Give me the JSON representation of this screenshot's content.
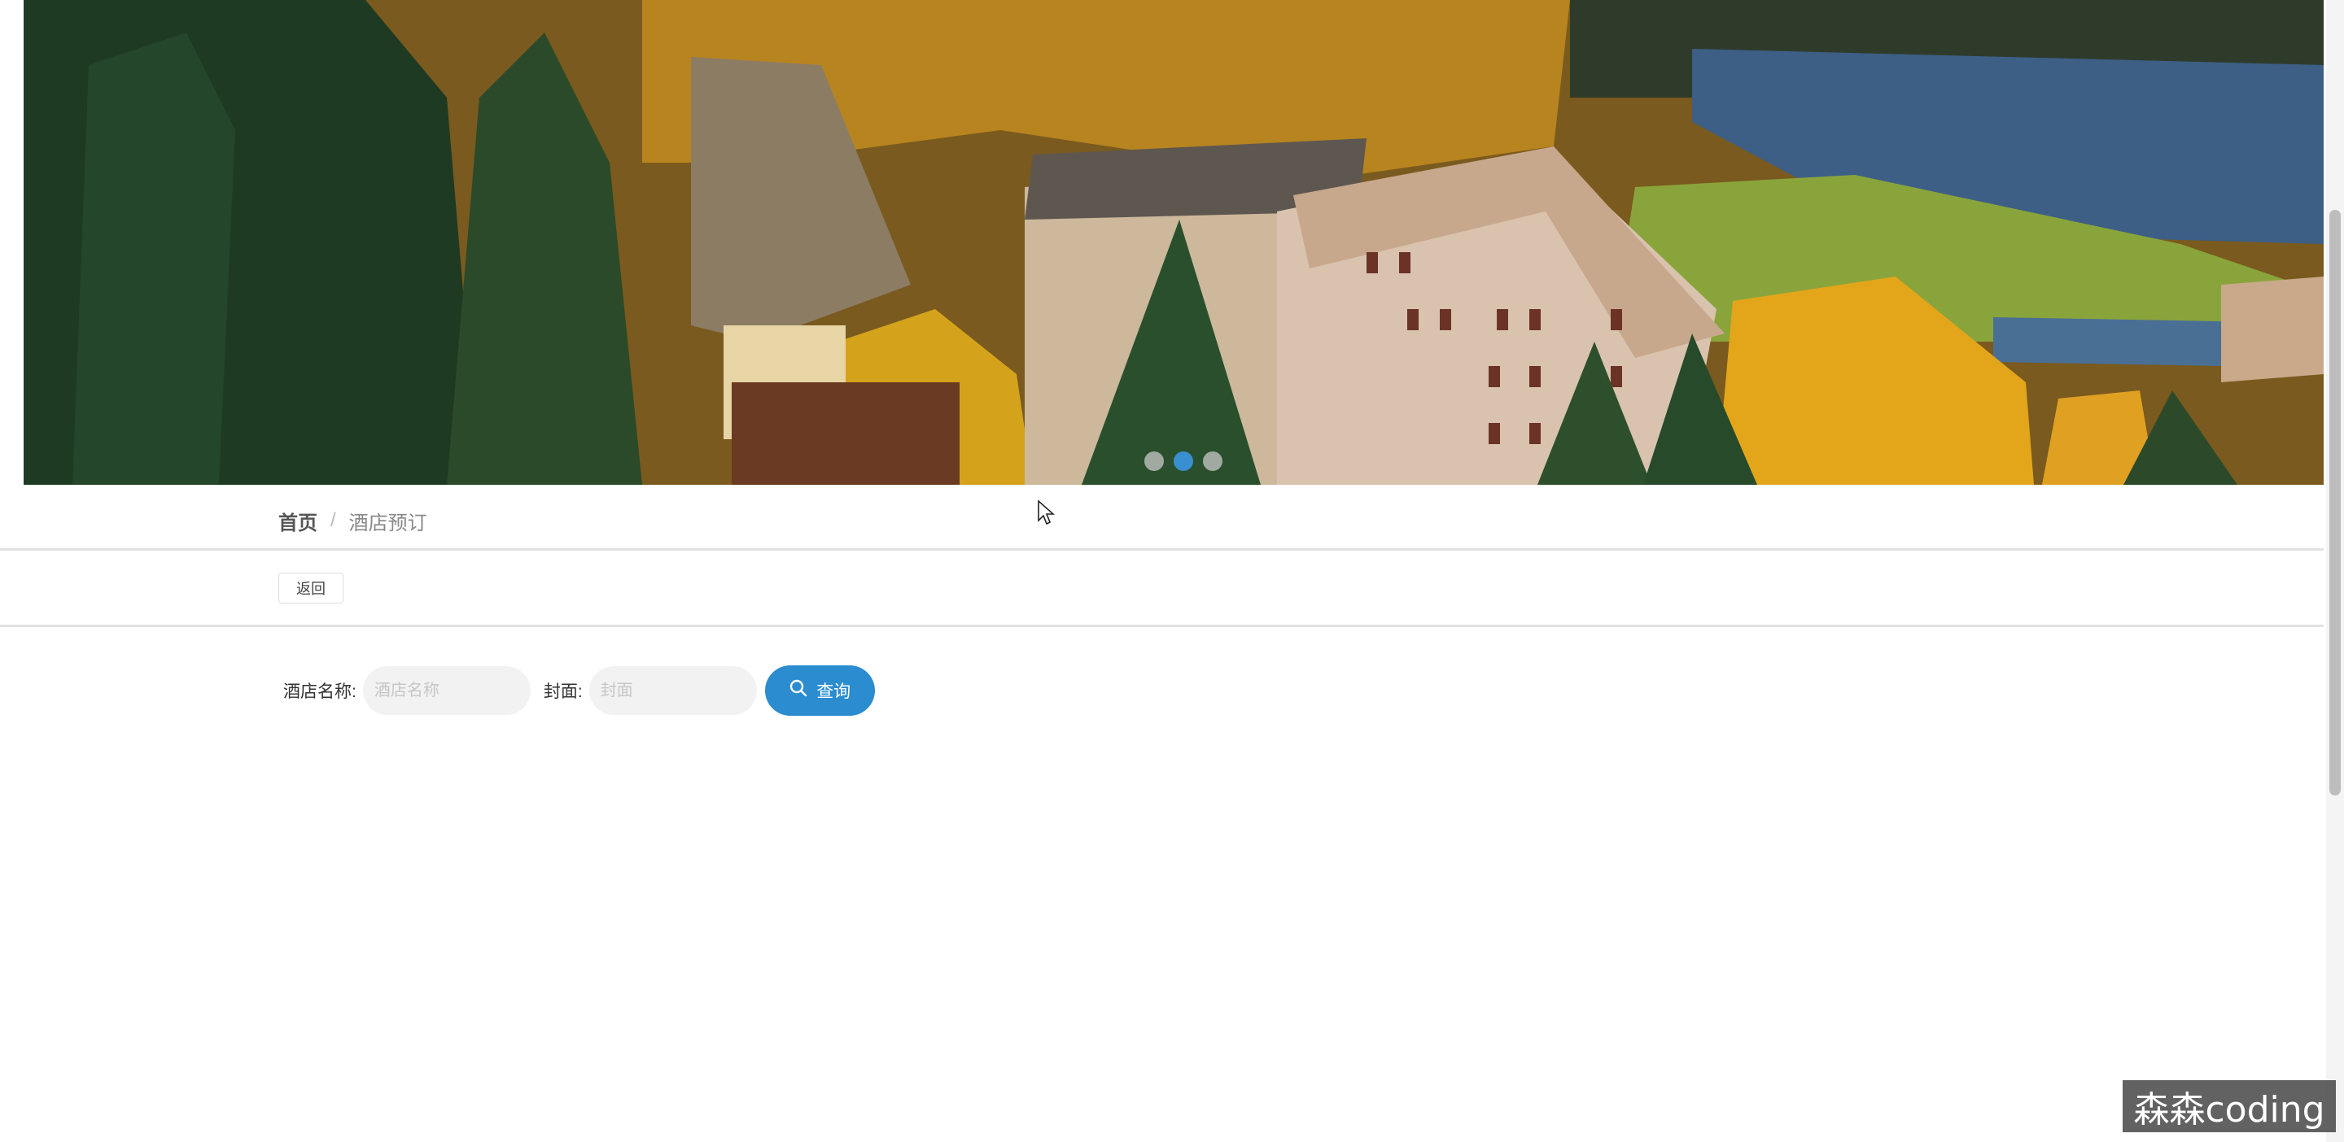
{
  "banner": {
    "alt": "St. Moritz hotels among autumn forest by a lake",
    "slides_count": 3,
    "active_slide_index": 1
  },
  "breadcrumb": {
    "home": "首页",
    "separator": "/",
    "current": "酒店预订"
  },
  "toolbar": {
    "back_label": "返回"
  },
  "search": {
    "hotel_name_label": "酒店名称:",
    "hotel_name_placeholder": "酒店名称",
    "hotel_name_value": "",
    "cover_label": "封面:",
    "cover_placeholder": "封面",
    "cover_value": "",
    "button_label": "查询",
    "button_icon": "search-icon"
  },
  "watermark": {
    "text": "森森coding"
  },
  "colors": {
    "primary": "#2b8ccf",
    "dot_active": "#3a8fd0",
    "divider": "#e2e2e2"
  }
}
